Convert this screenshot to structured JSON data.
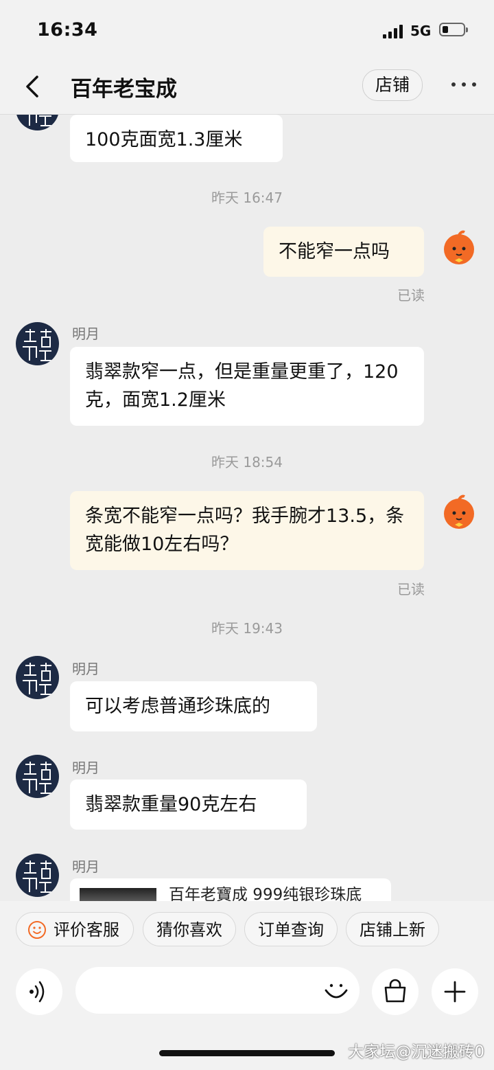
{
  "status_bar": {
    "time": "16:34",
    "network": "5G",
    "signal_bars": 4,
    "battery_level": 0.2
  },
  "header": {
    "title": "百年老宝成",
    "shop_button": "店铺"
  },
  "messages": [
    {
      "type": "text",
      "from": "shop",
      "text": "100克面宽1.3厘米"
    },
    {
      "type": "time",
      "text": "昨天 16:47"
    },
    {
      "type": "text",
      "from": "me",
      "text": "不能窄一点吗",
      "status": "已读"
    },
    {
      "type": "text",
      "from": "shop",
      "sender": "明月",
      "text": "翡翠款窄一点，但是重量更重了，120克，面宽1.2厘米"
    },
    {
      "type": "time",
      "text": "昨天 18:54"
    },
    {
      "type": "text",
      "from": "me",
      "text": "条宽不能窄一点吗？我手腕才13.5，条宽能做10左右吗？",
      "status": "已读"
    },
    {
      "type": "time",
      "text": "昨天 19:43"
    },
    {
      "type": "text",
      "from": "shop",
      "sender": "明月",
      "text": "可以考虑普通珍珠底的"
    },
    {
      "type": "text",
      "from": "shop",
      "sender": "明月",
      "text": "翡翠款重量90克左右"
    },
    {
      "type": "product",
      "from": "shop",
      "sender": "明月",
      "text": "百年老寶成 999纯银珍珠底"
    }
  ],
  "quick_actions": [
    "评价客服",
    "猜你喜欢",
    "订单查询",
    "店铺上新"
  ],
  "input": {
    "placeholder": ""
  },
  "watermark": "大家坛@沉迷搬砖0",
  "colors": {
    "my_bubble": "#fdf7e8",
    "their_bubble": "#ffffff",
    "background": "#ededed",
    "avatar": "#1d2a44",
    "mascot": "#f26a25"
  }
}
